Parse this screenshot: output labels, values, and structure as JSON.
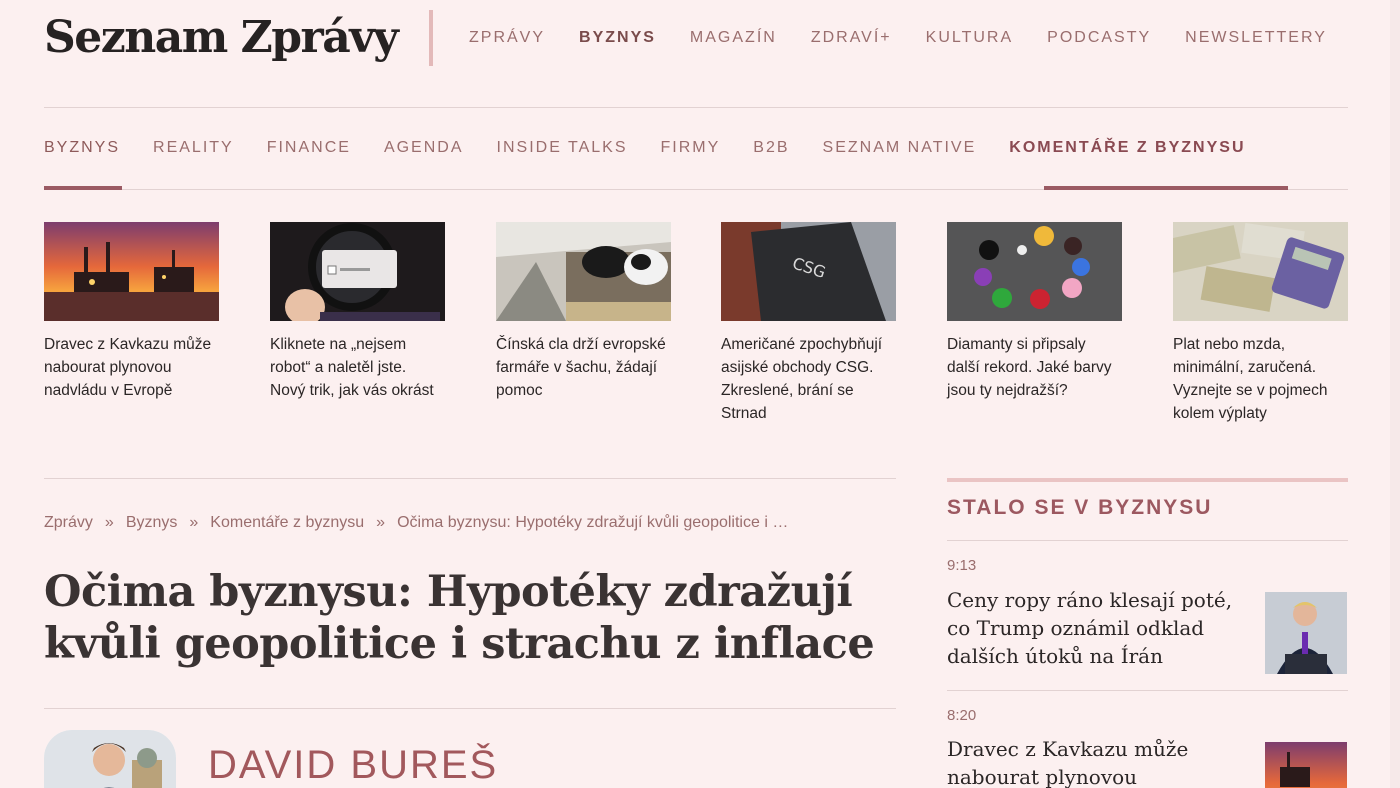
{
  "header": {
    "logo": "Seznam Zprávy",
    "nav": [
      {
        "label": "ZPRÁVY"
      },
      {
        "label": "BYZNYS"
      },
      {
        "label": "MAGAZÍN"
      },
      {
        "label": "ZDRAVÍ+"
      },
      {
        "label": "KULTURA"
      },
      {
        "label": "PODCASTY"
      },
      {
        "label": "NEWSLETTERY"
      }
    ]
  },
  "section_nav": [
    {
      "label": "BYZNYS"
    },
    {
      "label": "REALITY"
    },
    {
      "label": "FINANCE"
    },
    {
      "label": "AGENDA"
    },
    {
      "label": "INSIDE TALKS"
    },
    {
      "label": "FIRMY"
    },
    {
      "label": "B2B"
    },
    {
      "label": "SEZNAM NATIVE"
    },
    {
      "label": "KOMENTÁŘE Z BYZNYSU"
    }
  ],
  "teasers": [
    {
      "title": "Dravec z Kavkazu může nabourat plynovou nadvládu v Evropě"
    },
    {
      "title": "Kliknete na „nejsem robot“ a naletěl jste. Nový trik, jak vás okrást"
    },
    {
      "title": "Čínská cla drží evropské farmáře v šachu, žádají pomoc"
    },
    {
      "title": "Američané zpochybňují asijské obchody CSG. Zkreslené, brání se Strnad"
    },
    {
      "title": "Diamanty si připsaly další rekord. Jaké barvy jsou ty nejdražší?"
    },
    {
      "title": "Plat nebo mzda, minimální, zaručená. Vyznejte se v pojmech kolem výplaty"
    }
  ],
  "breadcrumb": {
    "items": [
      "Zprávy",
      "Byznys",
      "Komentáře z byznysu",
      "Očima byznysu: Hypotéky zdražují kvůli geopolitice i …"
    ],
    "separator": "»"
  },
  "article": {
    "headline": "Očima byznysu: Hypotéky zdražují kvůli geopolitice i strachu z inflace",
    "author": "DAVID BUREŠ"
  },
  "sidebar": {
    "title": "STALO SE V BYZNYSU",
    "items": [
      {
        "time": "9:13",
        "title": "Ceny ropy ráno klesají poté, co Trump oznámil odklad dalších útoků na Írán"
      },
      {
        "time": "8:20",
        "title": "Dravec z Kavkazu může nabourat plynovou"
      }
    ]
  }
}
